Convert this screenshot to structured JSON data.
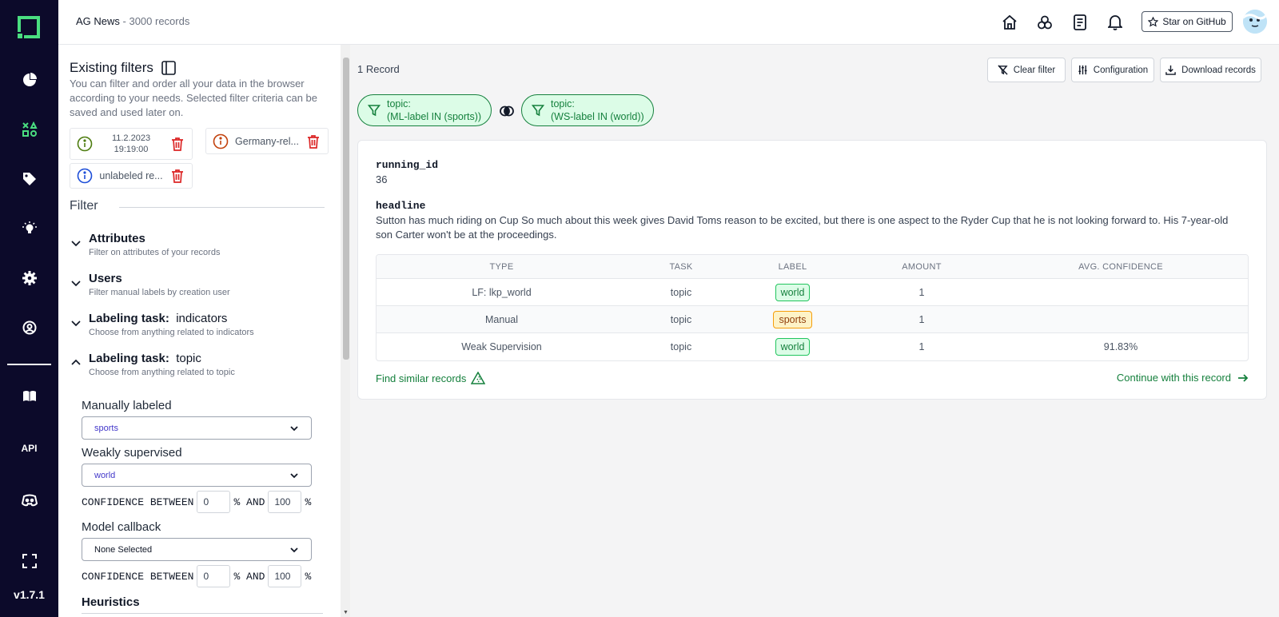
{
  "app": {
    "version": "v1.7.1",
    "api_label": "API"
  },
  "header": {
    "project_name": "AG News",
    "separator": " - ",
    "record_count": "3000 records",
    "github_label": "Star on GitHub"
  },
  "existing_filters": {
    "title": "Existing filters",
    "description": "You can filter and order all your data in the browser according to your needs. Selected filter criteria can be saved and used later on.",
    "items": [
      {
        "label": "11.2.2023 19:19:00",
        "line1": "11.2.2023",
        "line2": "19:19:00",
        "color": "#4d7c0f"
      },
      {
        "label": "Germany-rel...",
        "color": "#c2410c"
      },
      {
        "label": "unlabeled re...",
        "color": "#1d4ed8"
      }
    ]
  },
  "filter": {
    "title": "Filter",
    "sections": [
      {
        "title": "Attributes",
        "subtitle": "Filter on attributes of your records"
      },
      {
        "title": "Users",
        "subtitle": "Filter manual labels by creation user"
      },
      {
        "title": "Labeling task:",
        "name": "indicators",
        "subtitle": "Choose from anything related to indicators"
      },
      {
        "title": "Labeling task:",
        "name": "topic",
        "subtitle": "Choose from anything related to topic"
      }
    ],
    "topic": {
      "manual_label": "Manually labeled",
      "manual_value": "sports",
      "weak_label": "Weakly supervised",
      "weak_value": "world",
      "model_label": "Model callback",
      "model_value": "None Selected",
      "conf_text": "CONFIDENCE BETWEEN",
      "pct_and": "% AND",
      "pct": "%",
      "conf_min": "0",
      "conf_max": "100"
    },
    "heuristics_label": "Heuristics"
  },
  "main": {
    "record_count": "1 Record",
    "buttons": {
      "clear": "Clear filter",
      "config": "Configuration",
      "download": "Download records"
    },
    "pills": [
      {
        "line1": "topic:",
        "line2": "(ML-label IN (sports))"
      },
      {
        "line1": "topic:",
        "line2": "(WS-label IN (world))"
      }
    ],
    "record": {
      "fields": [
        {
          "key": "running_id",
          "value": "36"
        },
        {
          "key": "headline",
          "value": "Sutton has much riding on Cup So much about this week gives David Toms reason to be excited, but there is one aspect to the Ryder Cup that he is not looking forward to. His 7-year-old son Carter won't be at the proceedings."
        }
      ],
      "table": {
        "headers": [
          "TYPE",
          "TASK",
          "LABEL",
          "AMOUNT",
          "AVG. CONFIDENCE"
        ],
        "rows": [
          {
            "type": "LF: lkp_world",
            "task": "topic",
            "label": "world",
            "amount": "1",
            "confidence": ""
          },
          {
            "type": "Manual",
            "task": "topic",
            "label": "sports",
            "amount": "1",
            "confidence": ""
          },
          {
            "type": "Weak Supervision",
            "task": "topic",
            "label": "world",
            "amount": "1",
            "confidence": "91.83%"
          }
        ]
      },
      "find_similar": "Find similar records",
      "continue": "Continue with this record"
    }
  }
}
